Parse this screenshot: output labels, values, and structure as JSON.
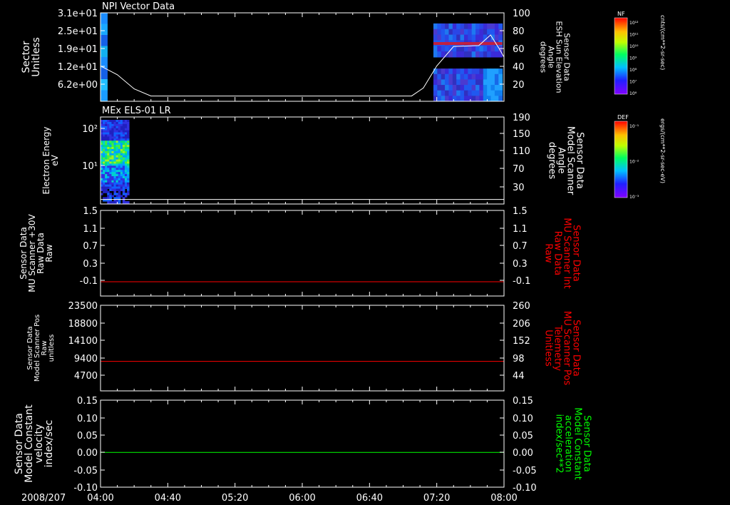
{
  "date_label": "2008/207",
  "x_ticks": [
    "04:00",
    "04:40",
    "05:20",
    "06:00",
    "06:40",
    "07:20",
    "08:00"
  ],
  "colors": {
    "axis": "#ffffff",
    "red": "#ff0000",
    "green": "#00ff00",
    "background": "#000000"
  },
  "chart_data": [
    {
      "type": "heatmap",
      "title": "NPI Vector Data",
      "ylabel_left": [
        "Sector",
        "Unitless"
      ],
      "ylabel_right": [
        "Sensor Data",
        "ESH Sun Elevation",
        "Angle",
        "degrees"
      ],
      "left_ticks": [
        "3.1e+01",
        "2.5e+01",
        "1.9e+01",
        "1.2e+01",
        "6.2e+00"
      ],
      "right_ticks": [
        "100",
        "80",
        "60",
        "40",
        "20"
      ],
      "right_ylim": [
        0,
        100
      ],
      "colorbar": {
        "label": "NF",
        "units": "cnts/(cm**2-sr-sec)",
        "ticks": [
          "10¹²",
          "10¹¹",
          "10¹⁰",
          "10⁹",
          "10⁸",
          "10⁷",
          "10⁶"
        ]
      },
      "line_series": {
        "name": "ESH Sun Elevation Angle",
        "points": [
          [
            "04:00",
            40
          ],
          [
            "04:10",
            30
          ],
          [
            "04:20",
            14
          ],
          [
            "04:30",
            6
          ],
          [
            "05:00",
            6
          ],
          [
            "06:00",
            6
          ],
          [
            "07:05",
            6
          ],
          [
            "07:12",
            15
          ],
          [
            "07:20",
            40
          ],
          [
            "07:30",
            62
          ],
          [
            "07:45",
            63
          ],
          [
            "07:52",
            75
          ],
          [
            "07:57",
            60
          ],
          [
            "08:00",
            50
          ]
        ]
      },
      "heatmap_blocks": [
        {
          "x": [
            "04:00",
            "04:04"
          ],
          "y": [
            0,
            100
          ]
        },
        {
          "x": [
            "07:18",
            "07:59"
          ],
          "y": [
            50,
            88
          ]
        },
        {
          "x": [
            "07:18",
            "07:59"
          ],
          "y": [
            0,
            37
          ]
        }
      ]
    },
    {
      "type": "heatmap",
      "title": "MEx ELS-01 LR",
      "ylabel_left": [
        "Electron Energy",
        "eV"
      ],
      "ylabel_right": [
        "Sensor Data",
        "Model Scanner",
        "Angle",
        "degrees"
      ],
      "left_ticks": [
        "10²",
        "10¹"
      ],
      "right_ticks": [
        "190",
        "150",
        "110",
        "70",
        "30"
      ],
      "right_ylim": [
        0,
        190
      ],
      "colorbar": {
        "label": "DEF",
        "units": "ergs/(cm**2-sr-sec-eV)",
        "ticks": [
          "10⁻¹",
          "10⁻²",
          "10⁻³"
        ]
      },
      "line_series": {
        "name": "Model Scanner Angle",
        "value": 10
      },
      "heatmap_blocks": [
        {
          "x": [
            "04:00",
            "04:17"
          ],
          "energy_ev": [
            2,
            200
          ]
        }
      ]
    },
    {
      "type": "line",
      "title": "",
      "ylabel_left": [
        "Sensor Data",
        "MU Scanner +30V",
        "Raw Data",
        "Raw"
      ],
      "ylabel_right": [
        "Sensor Data",
        "MU Scanner Int",
        "Raw Data",
        "Raw"
      ],
      "left_ticks": [
        "1.5",
        "1.1",
        "0.7",
        "0.3",
        "-0.1"
      ],
      "right_ticks": [
        "1.5",
        "1.1",
        "0.7",
        "0.3",
        "-0.1"
      ],
      "ylim": [
        -0.3,
        1.5
      ],
      "series": [
        {
          "value": 0.0,
          "color": "#ff0000"
        }
      ]
    },
    {
      "type": "line",
      "title": "",
      "ylabel_left": [
        "Sensor Data",
        "Model Scanner Pos",
        "Raw",
        "unitless"
      ],
      "ylabel_right": [
        "Sensor Data",
        "MU Scanner Pos",
        "Telemetry",
        "Unitless"
      ],
      "left_ticks": [
        "23500",
        "18800",
        "14100",
        "9400",
        "4700"
      ],
      "right_ticks": [
        "260",
        "206",
        "152",
        "98",
        "44"
      ],
      "ylim": [
        0,
        23500
      ],
      "series": [
        {
          "value": 8100,
          "color": "#ff0000"
        }
      ]
    },
    {
      "type": "line",
      "title": "",
      "ylabel_left": [
        "Sensor Data",
        "Model Constant",
        "velocity",
        "index/sec"
      ],
      "ylabel_right": [
        "Sensor Data",
        "Model Constant",
        "acceleration",
        "index/sec**2"
      ],
      "left_ticks": [
        "0.15",
        "0.10",
        "0.05",
        "0.00",
        "-0.05",
        "-0.10"
      ],
      "right_ticks": [
        "0.15",
        "0.10",
        "0.05",
        "0.00",
        "-0.05",
        "-0.10"
      ],
      "ylim": [
        -0.1,
        0.15
      ],
      "series": [
        {
          "value": 0.0,
          "color": "#00ff00"
        }
      ]
    }
  ]
}
